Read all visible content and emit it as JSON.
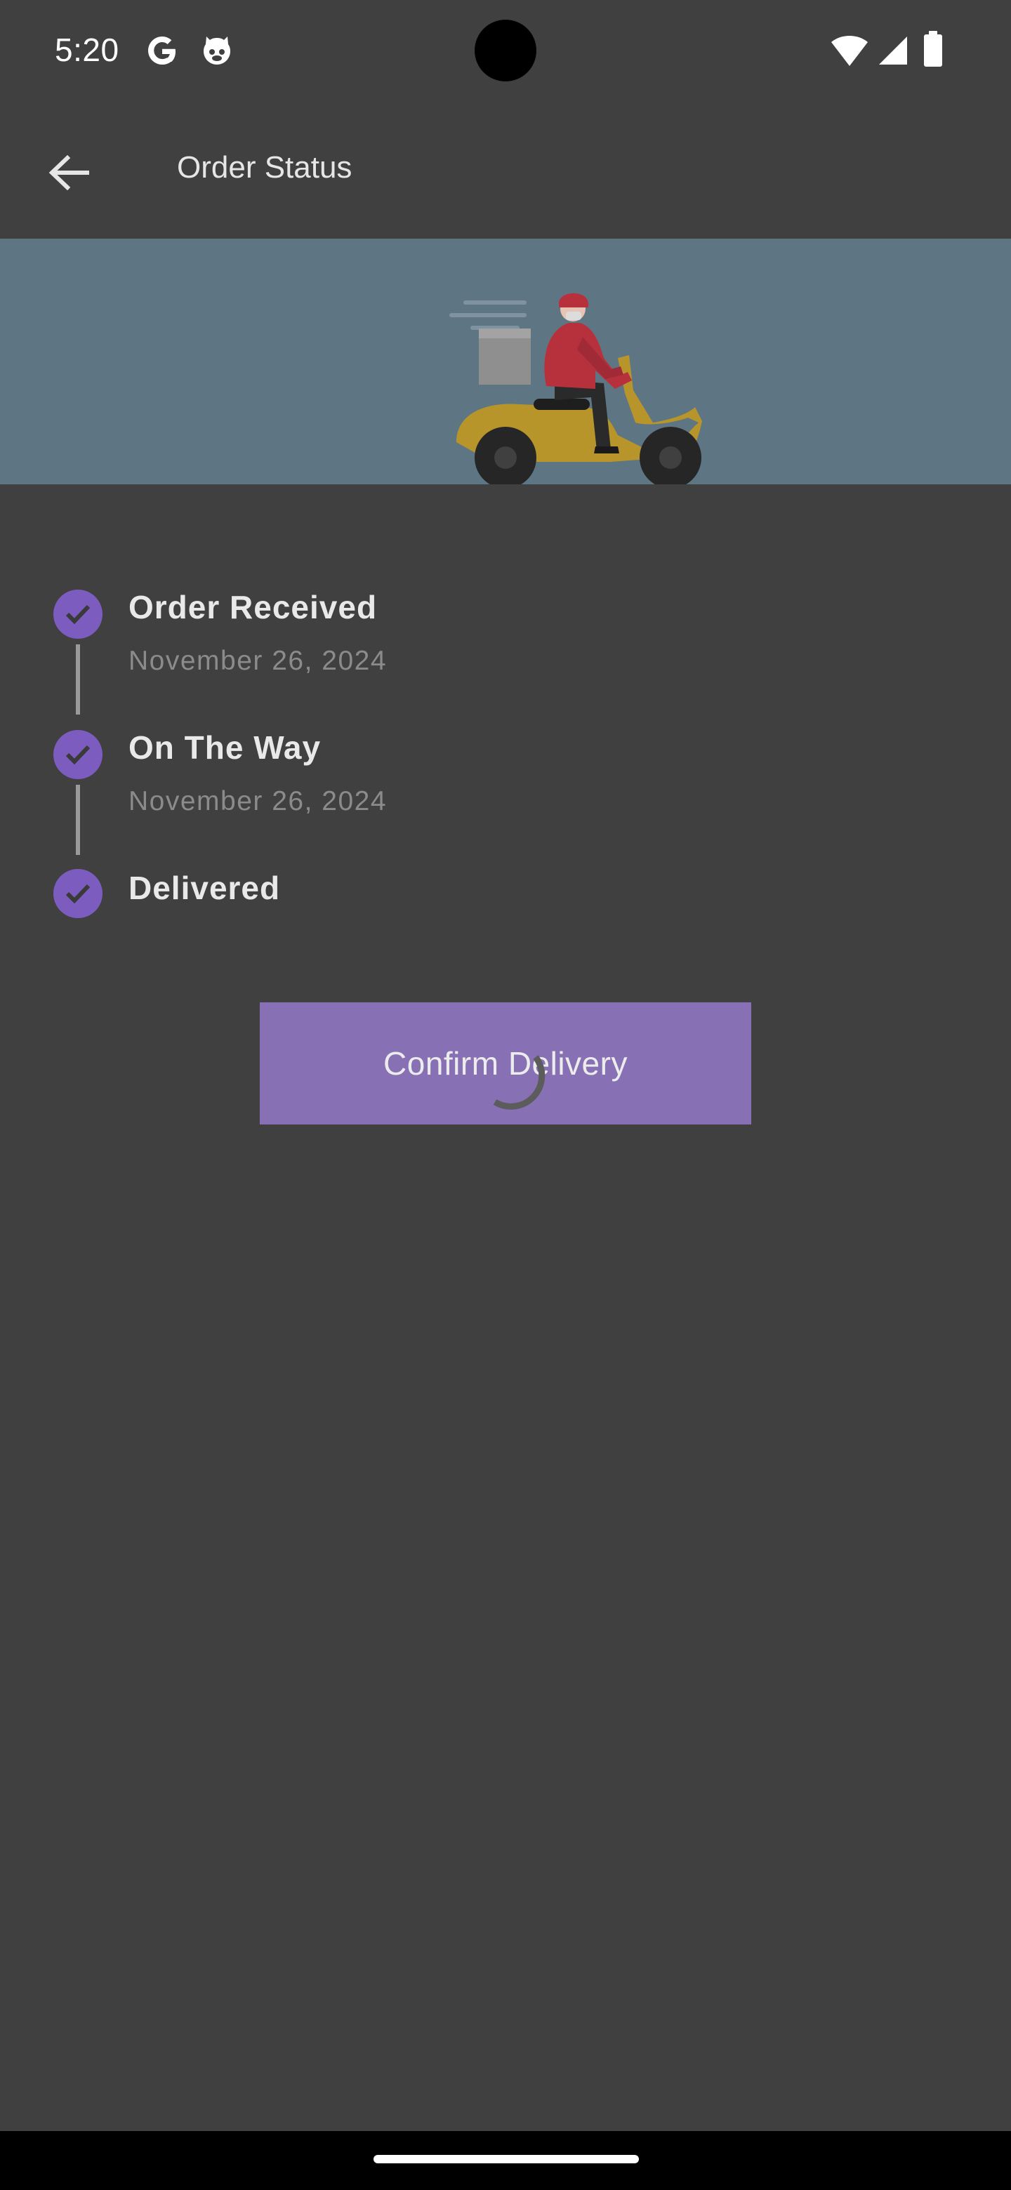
{
  "status_bar": {
    "time": "5:20",
    "left_icons": [
      "google-icon",
      "cat-face-icon"
    ],
    "right_icons": [
      "wifi-icon",
      "signal-icon",
      "battery-icon"
    ]
  },
  "app_bar": {
    "title": "Order Status",
    "back_icon": "arrow-left-icon"
  },
  "hero": {
    "illustration": "delivery-scooter-illustration",
    "colors": {
      "background": "#5e7683",
      "scooter": "#b8952a",
      "rider": "#b7313d"
    }
  },
  "timeline": {
    "steps": [
      {
        "title": "Order Received",
        "date": "November 26, 2024",
        "completed": true
      },
      {
        "title": "On The Way",
        "date": "November 26, 2024",
        "completed": true
      },
      {
        "title": "Delivered",
        "completed": true
      }
    ]
  },
  "confirm_button": {
    "label": "Confirm Delivery",
    "loading": true
  },
  "colors": {
    "background": "#404040",
    "accent": "#7d5cbf",
    "button": "#8870b5"
  }
}
